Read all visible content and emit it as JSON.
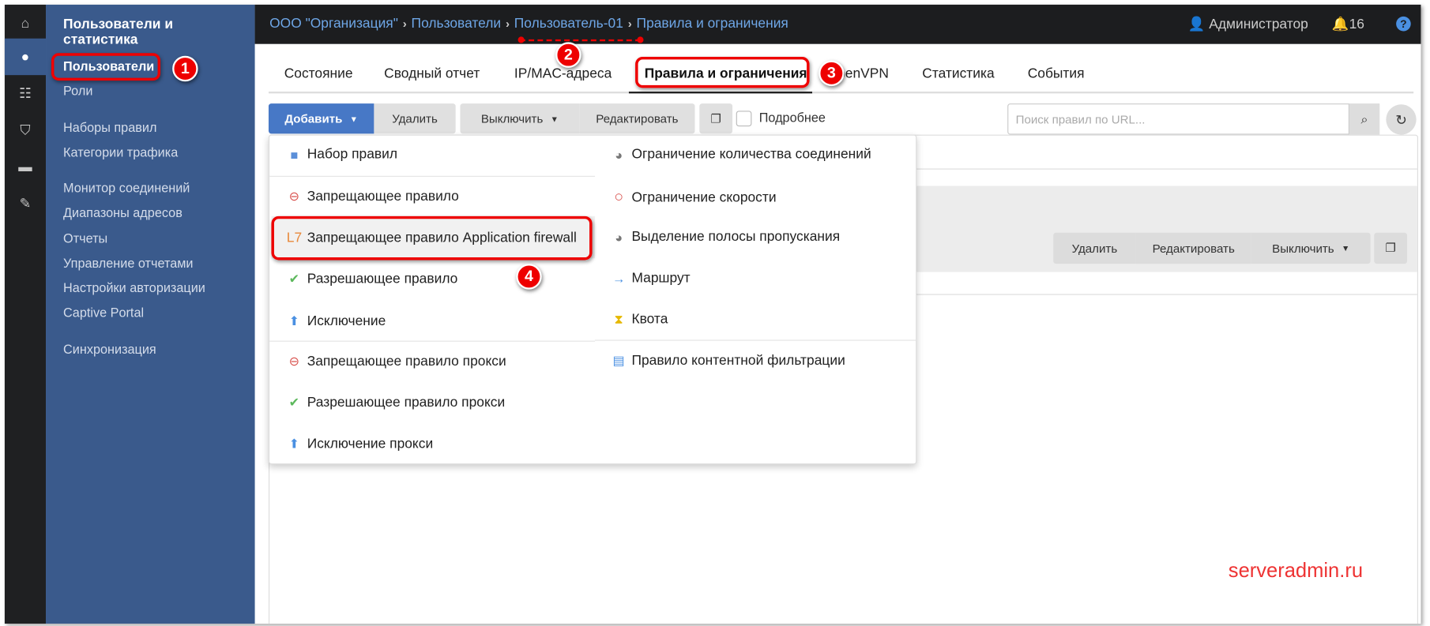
{
  "colors": {
    "accent": "#4778c6",
    "sidebar": "#3a5a8c",
    "topbar": "#1c1d1f",
    "annotation": "#e00000",
    "link": "#6ea6e6"
  },
  "iconbar": [
    "home-icon",
    "user-icon",
    "sitemap-icon",
    "shield-icon",
    "folder-icon",
    "wrench-icon"
  ],
  "sidebar": {
    "title": "Пользователи и статистика",
    "items": [
      "Пользователи",
      "Роли",
      "Наборы правил",
      "Категории трафика",
      "Монитор соединений",
      "Диапазоны адресов",
      "Отчеты",
      "Управление отчетами",
      "Настройки авторизации",
      "Captive Portal",
      "Синхронизация"
    ]
  },
  "breadcrumb": [
    "ООО \"Организация\"",
    "Пользователи",
    "Пользователь-01",
    "Правила и ограничения"
  ],
  "topbar": {
    "user": "Администратор",
    "notifications": "16",
    "help": "?"
  },
  "tabs": [
    "Состояние",
    "Сводный отчет",
    "IP/MAC-адреса",
    "Правила и ограничения",
    "OpenVPN",
    "Статистика",
    "События"
  ],
  "toolbar": {
    "add": "Добавить",
    "delete": "Удалить",
    "disable": "Выключить",
    "edit": "Редактировать",
    "details": "Подробнее",
    "search_placeholder": "Поиск правил по URL..."
  },
  "row_actions": {
    "delete": "Удалить",
    "edit": "Редактировать",
    "disable": "Выключить"
  },
  "dropdown": {
    "left": [
      {
        "icon": "folder-icon",
        "label": "Набор правил"
      },
      {
        "icon": "minus-circle-icon",
        "label": "Запрещающее правило"
      },
      {
        "icon": "l7-icon",
        "icon_text": "L7",
        "label": "Запрещающее правило Application firewall"
      },
      {
        "icon": "check-circle-icon",
        "label": "Разрешающее правило"
      },
      {
        "icon": "arrow-up-circle-icon",
        "label": "Исключение"
      },
      {
        "icon": "minus-circle-icon",
        "label": "Запрещающее правило прокси"
      },
      {
        "icon": "check-circle-icon",
        "label": "Разрешающее правило прокси"
      },
      {
        "icon": "arrow-up-circle-icon",
        "label": "Исключение прокси"
      }
    ],
    "right": [
      {
        "icon": "tachometer-icon",
        "label": "Ограничение количества соединений"
      },
      {
        "icon": "circle-outline-icon",
        "label": "Ограничение скорости"
      },
      {
        "icon": "tachometer-icon",
        "label": "Выделение полосы пропускания"
      },
      {
        "icon": "arrow-right-icon",
        "label": "Маршрут"
      },
      {
        "icon": "hourglass-icon",
        "label": "Квота"
      },
      {
        "icon": "file-icon",
        "label": "Правило контентной фильтрации"
      }
    ]
  },
  "annotations": [
    "1",
    "2",
    "3",
    "4"
  ],
  "watermark": "serveradmin.ru"
}
